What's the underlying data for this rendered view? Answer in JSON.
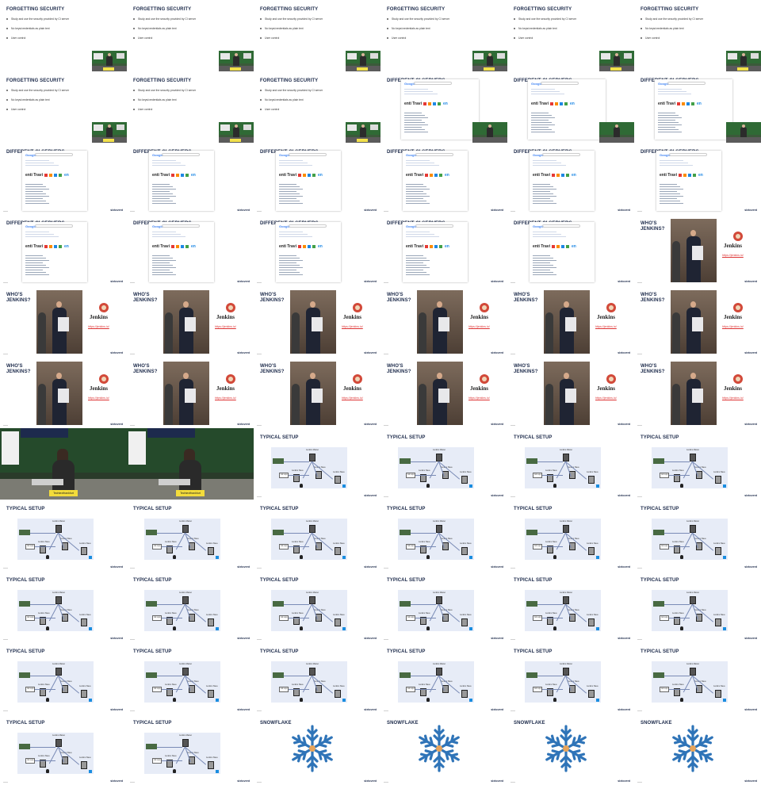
{
  "slides": {
    "forgetting_security": {
      "title": "FORGETTING SECURITY",
      "bullets": [
        "Study and use the security provided by CI server",
        "No keys/credentials as plain text",
        "User control"
      ]
    },
    "different_ci": {
      "title": "DIFFERENT CI SERVERS",
      "google_logo": "Google",
      "icons_text": "enti Travi",
      "icons_blue": "en"
    },
    "whos_jenkins": {
      "title": "WHO'S JENKINS?",
      "logo_name": "Jenkins",
      "link": "https://jenkins.io/"
    },
    "typical_setup": {
      "title": "TYPICAL SETUP",
      "labels": [
        "Jenkins Master",
        "Jenkins Slave",
        "Jenkins Slave",
        "Jenkins Slave",
        "Git repo"
      ]
    },
    "snowflake": {
      "title": "SNOWFLAKE"
    },
    "video": {
      "sign": "Techtextfrankfurt"
    }
  },
  "brand": "sixtovent",
  "colors": {
    "title": "#1c2a4a",
    "link": "#dd3333",
    "snowflake": "#2f74b8",
    "diagram_bg": "#e7ecf7"
  },
  "grid": [
    [
      "forgetting_security",
      "forgetting_security",
      "forgetting_security",
      "forgetting_security",
      "forgetting_security",
      "forgetting_security"
    ],
    [
      "forgetting_security",
      "forgetting_security",
      "forgetting_security",
      "different_ci_transition",
      "different_ci_transition",
      "different_ci_transition"
    ],
    [
      "different_ci",
      "different_ci",
      "different_ci",
      "different_ci",
      "different_ci",
      "different_ci"
    ],
    [
      "different_ci",
      "different_ci",
      "different_ci",
      "different_ci",
      "different_ci",
      "whos_jenkins"
    ],
    [
      "whos_jenkins",
      "whos_jenkins",
      "whos_jenkins",
      "whos_jenkins",
      "whos_jenkins",
      "whos_jenkins"
    ],
    [
      "whos_jenkins",
      "whos_jenkins",
      "whos_jenkins",
      "whos_jenkins",
      "whos_jenkins",
      "whos_jenkins"
    ],
    [
      "video",
      "video",
      "typical_setup",
      "typical_setup",
      "typical_setup",
      "typical_setup"
    ],
    [
      "typical_setup",
      "typical_setup",
      "typical_setup",
      "typical_setup",
      "typical_setup",
      "typical_setup"
    ],
    [
      "typical_setup",
      "typical_setup",
      "typical_setup",
      "typical_setup",
      "typical_setup",
      "typical_setup"
    ],
    [
      "typical_setup",
      "typical_setup",
      "typical_setup",
      "typical_setup",
      "typical_setup",
      "typical_setup"
    ],
    [
      "typical_setup",
      "typical_setup",
      "snowflake",
      "snowflake",
      "snowflake",
      "snowflake"
    ]
  ]
}
